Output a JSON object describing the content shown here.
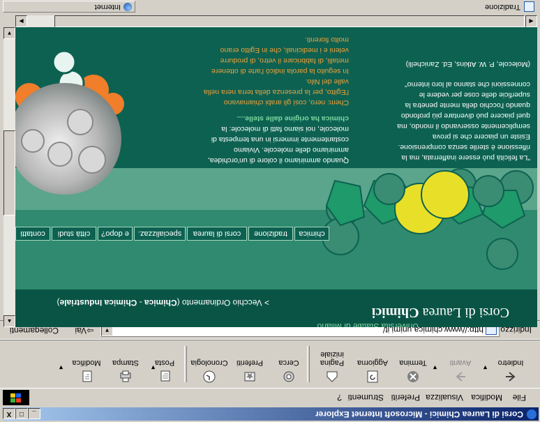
{
  "window": {
    "title": "Corsi di Laurea Chimici - Microsoft Internet Explorer",
    "buttons": [
      "_",
      "□",
      "X"
    ]
  },
  "menu": {
    "items": [
      "File",
      "Modifica",
      "Visualizza",
      "Preferiti",
      "Strumenti",
      "?"
    ]
  },
  "toolbar": {
    "back": "Indietro",
    "forward": "Avanti",
    "stop": "Termina",
    "refresh": "Aggiorna",
    "home": "Pagina iniziale",
    "search": "Cerca",
    "favorites": "Preferiti",
    "history": "Cronologia",
    "mail": "Posta",
    "print": "Stampa",
    "edit": "Modifica"
  },
  "address": {
    "label": "Indirizzo",
    "url": "http://www.chimica.unimi.it/",
    "go": "Vai",
    "links": "Collegamenti"
  },
  "page": {
    "title_prefix": "Corsi di Laurea",
    "title_bold": "Chimici",
    "university": "Università Statale di Milano",
    "old_order_prefix": "> Vecchio Ordinamento (",
    "old_order_1": "Chimica",
    "old_order_sep": " - ",
    "old_order_2": "Chimica Industriale",
    "old_order_suffix": ")",
    "nav": [
      "chimica",
      "tradizione",
      "corsi di laurea",
      "specializzaz.",
      "e dopo?",
      "città studi",
      "contatti"
    ],
    "quote_lines": [
      "\"La felicità può essere inafferrata, ma la",
      "riflessione è sterile senza comprensione.",
      "Esiste un piacere che si prova",
      "semplicemente osservando il mondo, ma",
      "quel piacere può diventare più profondo",
      "quando l'occhio della mente penetra la",
      "superficie delle cose per vedere le",
      "connessioni che stanno al loro interno\""
    ],
    "quote_source": "(Molecole, P. W. Atkins, Ed. Zanichelli)",
    "chem_p1_lines": [
      "Quando ammiriamo il colore di un'orchidea,",
      "ammiriamo delle molecole. Viviamo",
      "costantemente immersi in una tempesta di",
      "molecole, noi siamo fatti di molecole: la",
      "chimica ha origine dalle stelle...."
    ],
    "chem_p2_lines": [
      "Chem: nero, così gli arabi chiamavano",
      "l'Egitto, per la presenza della terra nera nella",
      "valle del Nilo.",
      "In seguito la parola indicò l'arte di ottenere",
      "metalli, di fabbricare il vetro, di produrre",
      "veleni e i medicinali, che in Egitto erano",
      "molto fiorenti."
    ]
  },
  "status": {
    "text": "Tradizione",
    "zone": "Internet"
  },
  "colors": {
    "page_bg": "#0d6151",
    "band": "#2f8a6f",
    "accent_orange": "#f2a23c",
    "molecule_yellow": "#e8e028",
    "molecule_green": "#1f9a6a",
    "title_bar": "#0a246a"
  }
}
